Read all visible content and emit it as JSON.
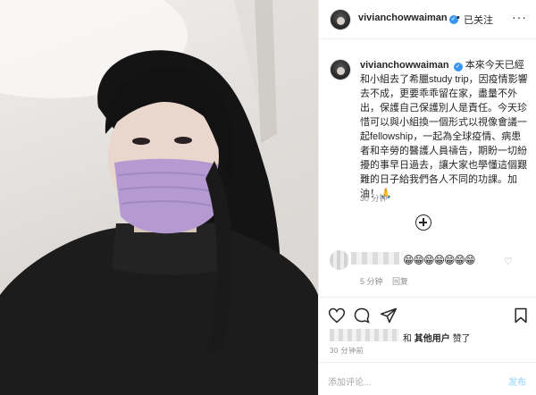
{
  "post": {
    "username": "vivianchowwaiman",
    "verified_icon": "verified-badge-icon",
    "header_separator": "•",
    "follow_status": "已关注",
    "more_icon": "more-options-icon",
    "more_glyph": "···"
  },
  "caption": {
    "username": "vivianchowwaiman",
    "text": "本來今天已經和小組去了希臘study trip，因疫情影響去不成，更要乖乖留在家，盡量不外出，保護自己保護別人是責任。今天珍惜可以與小組換一個形式以視像會議一起fellowship，一起為全球疫情、病患者和辛勞的醫護人員禱告，期盼一切紛擾的事早日過去，讓大家也學懂這個艱難的日子給我們各人不同的功課。加油！🙏",
    "time": "30 分钟"
  },
  "load_more_icon": "load-more-comments-icon",
  "comment": {
    "emojis": "😁😁😁😁😁😁😁",
    "time": "5 分钟",
    "reply_label": "回复",
    "like_icon": "heart-outline-icon",
    "heart_glyph": "♡"
  },
  "actions": {
    "like_icon": "heart-icon",
    "comment_icon": "comment-icon",
    "share_icon": "share-icon",
    "save_icon": "bookmark-icon"
  },
  "likes": {
    "and_label": "和",
    "others_label": "其他用户",
    "liked_label": "赞了"
  },
  "post_time": "30 分钟前",
  "add_comment": {
    "placeholder": "添加评论...",
    "post_label": "发布"
  },
  "colors": {
    "verified_blue": "#3897f0",
    "post_button_disabled": "#b2dffc",
    "mask_lavender": "#b49ad1"
  }
}
